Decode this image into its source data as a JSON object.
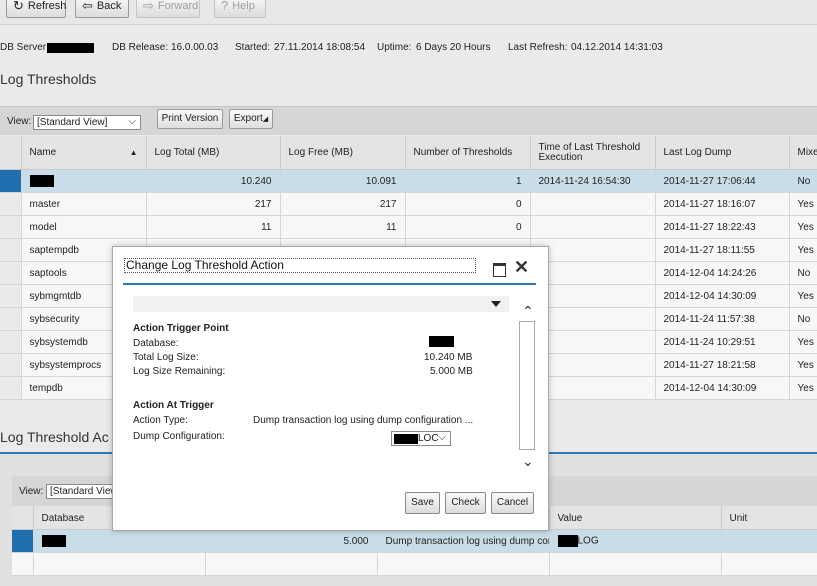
{
  "toolbar": {
    "refresh": "Refresh",
    "back": "Back",
    "forward": "Forward",
    "help": "Help"
  },
  "info": {
    "db_server_label": "DB Server:",
    "db_release_label": "DB Release:",
    "db_release": "16.0.00.03",
    "started_label": "Started:",
    "started": "27.11.2014 18:08:54",
    "uptime_label": "Uptime:",
    "uptime": "6 Days 20  Hours",
    "last_refresh_label": "Last Refresh:",
    "last_refresh": "04.12.2014 14:31:03"
  },
  "log_thresholds": {
    "title": "Log Thresholds",
    "view_label": "View:",
    "view_value": "[Standard View]",
    "print_button": "Print Version",
    "export_button": "Export",
    "columns": [
      "Name",
      "Log Total (MB)",
      "Log Free (MB)",
      "Number of Thresholds",
      "Time of Last Threshold Execution",
      "Last Log Dump",
      "Mixed"
    ],
    "rows": [
      {
        "name": "",
        "total": "10.240",
        "free": "10.091",
        "thresholds": "1",
        "last_exec": "2014-11-24 16:54:30",
        "last_dump": "2014-11-27 17:06:44",
        "mixed": "No"
      },
      {
        "name": "master",
        "total": "217",
        "free": "217",
        "thresholds": "0",
        "last_exec": "",
        "last_dump": "2014-11-27 18:16:07",
        "mixed": "Yes"
      },
      {
        "name": "model",
        "total": "11",
        "free": "11",
        "thresholds": "0",
        "last_exec": "",
        "last_dump": "2014-11-27 18:22:43",
        "mixed": "Yes"
      },
      {
        "name": "saptempdb",
        "total": "",
        "free": "",
        "thresholds": "",
        "last_exec": "",
        "last_dump": "2014-11-27 18:11:55",
        "mixed": "Yes"
      },
      {
        "name": "saptools",
        "total": "",
        "free": "",
        "thresholds": "",
        "last_exec": "",
        "last_dump": "2014-12-04 14:24:26",
        "mixed": "No"
      },
      {
        "name": "sybmgmtdb",
        "total": "",
        "free": "",
        "thresholds": "",
        "last_exec": "",
        "last_dump": "2014-12-04 14:30:09",
        "mixed": "Yes"
      },
      {
        "name": "sybsecurity",
        "total": "",
        "free": "",
        "thresholds": "",
        "last_exec": "",
        "last_dump": "2014-11-24 11:57:38",
        "mixed": "No"
      },
      {
        "name": "sybsystemdb",
        "total": "",
        "free": "",
        "thresholds": "",
        "last_exec": "",
        "last_dump": "2014-11-24 10:29:51",
        "mixed": "Yes"
      },
      {
        "name": "sybsystemprocs",
        "total": "",
        "free": "",
        "thresholds": "",
        "last_exec": "",
        "last_dump": "2014-11-27 18:21:58",
        "mixed": "Yes"
      },
      {
        "name": "tempdb",
        "total": "",
        "free": "",
        "thresholds": "",
        "last_exec": "",
        "last_dump": "2014-12-04 14:30:09",
        "mixed": "Yes"
      }
    ]
  },
  "log_threshold_actions": {
    "title": "Log Threshold Ac",
    "view_label": "View:",
    "view_value": "[Standard View",
    "columns": [
      "Database",
      "",
      "",
      "Value",
      "Unit"
    ],
    "rows": [
      {
        "database": "",
        "amount": "5.000",
        "action": "Dump transaction log using dump con...",
        "value": "LOG",
        "unit": ""
      }
    ]
  },
  "dialog": {
    "title": "Change Log Threshold Action",
    "trigger_heading": "Action Trigger Point",
    "database_label": "Database:",
    "total_size_label": "Total Log Size:",
    "total_size_value": "10.240 MB",
    "remaining_label": "Log Size Remaining:",
    "remaining_value": "5.000  MB",
    "at_trigger_heading": "Action At Trigger",
    "action_type_label": "Action Type:",
    "action_type_value": "Dump transaction log using dump configuration ...",
    "dump_config_label": "Dump Configuration:",
    "dump_config_value": "LOC",
    "save": "Save",
    "check": "Check",
    "cancel": "Cancel"
  }
}
